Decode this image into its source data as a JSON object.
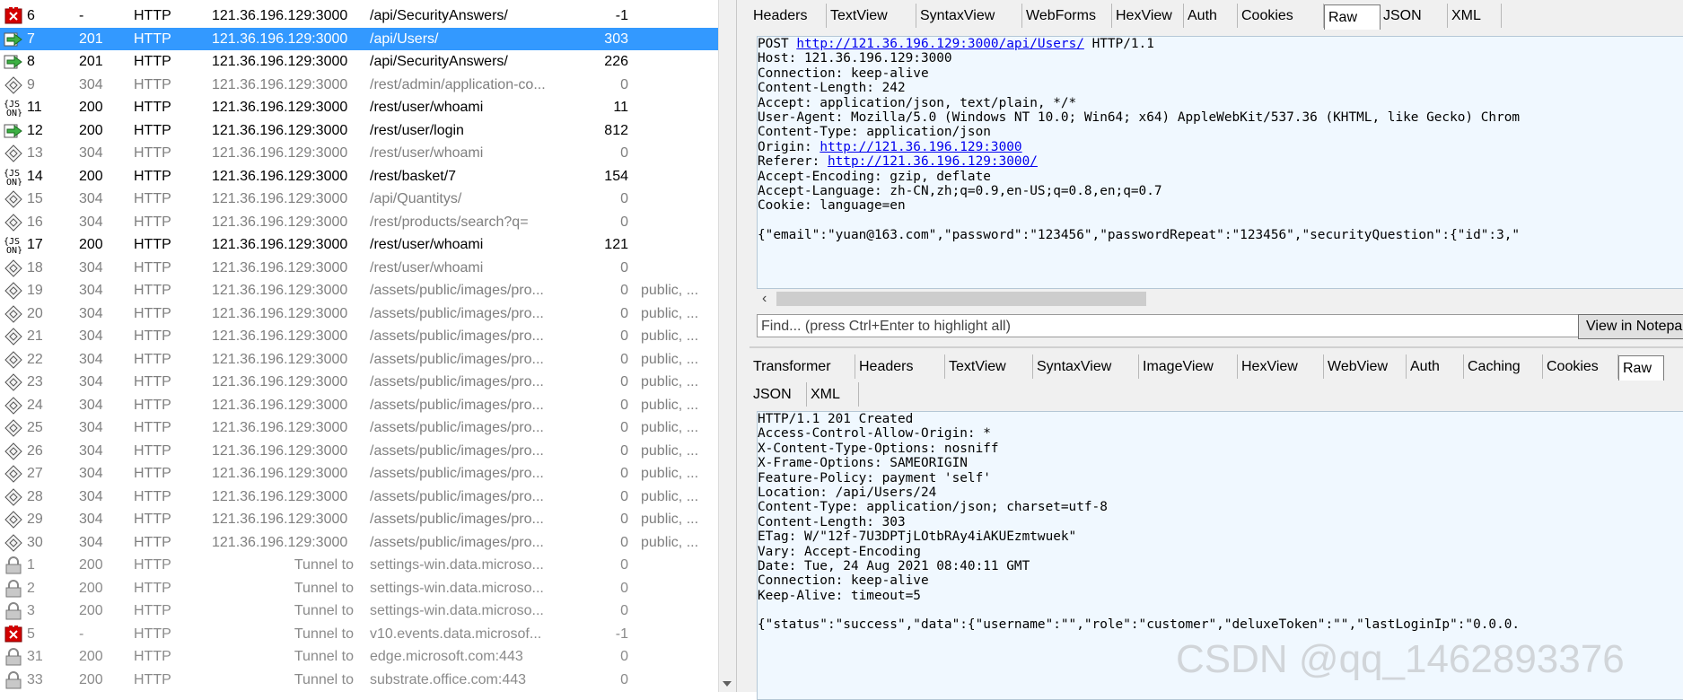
{
  "sessions": [
    {
      "num": "6",
      "result": "-",
      "protocol": "HTTP",
      "host": "121.36.196.129:3000",
      "url": "/api/SecurityAnswers/",
      "body": "-1",
      "caching": "",
      "icon": "error-icon",
      "style": "normal"
    },
    {
      "num": "7",
      "result": "201",
      "protocol": "HTTP",
      "host": "121.36.196.129:3000",
      "url": "/api/Users/",
      "body": "303",
      "caching": "",
      "icon": "post-arrow-icon",
      "style": "selected"
    },
    {
      "num": "8",
      "result": "201",
      "protocol": "HTTP",
      "host": "121.36.196.129:3000",
      "url": "/api/SecurityAnswers/",
      "body": "226",
      "caching": "",
      "icon": "post-arrow-icon",
      "style": "normal"
    },
    {
      "num": "9",
      "result": "304",
      "protocol": "HTTP",
      "host": "121.36.196.129:3000",
      "url": "/rest/admin/application-co...",
      "body": "0",
      "caching": "",
      "icon": "not-modified-icon",
      "style": "gray"
    },
    {
      "num": "11",
      "result": "200",
      "protocol": "HTTP",
      "host": "121.36.196.129:3000",
      "url": "/rest/user/whoami",
      "body": "11",
      "caching": "",
      "icon": "json-icon",
      "style": "normal"
    },
    {
      "num": "12",
      "result": "200",
      "protocol": "HTTP",
      "host": "121.36.196.129:3000",
      "url": "/rest/user/login",
      "body": "812",
      "caching": "",
      "icon": "post-arrow-icon",
      "style": "normal"
    },
    {
      "num": "13",
      "result": "304",
      "protocol": "HTTP",
      "host": "121.36.196.129:3000",
      "url": "/rest/user/whoami",
      "body": "0",
      "caching": "",
      "icon": "not-modified-icon",
      "style": "gray"
    },
    {
      "num": "14",
      "result": "200",
      "protocol": "HTTP",
      "host": "121.36.196.129:3000",
      "url": "/rest/basket/7",
      "body": "154",
      "caching": "",
      "icon": "json-icon",
      "style": "normal"
    },
    {
      "num": "15",
      "result": "304",
      "protocol": "HTTP",
      "host": "121.36.196.129:3000",
      "url": "/api/Quantitys/",
      "body": "0",
      "caching": "",
      "icon": "not-modified-icon",
      "style": "gray"
    },
    {
      "num": "16",
      "result": "304",
      "protocol": "HTTP",
      "host": "121.36.196.129:3000",
      "url": "/rest/products/search?q=",
      "body": "0",
      "caching": "",
      "icon": "not-modified-icon",
      "style": "gray"
    },
    {
      "num": "17",
      "result": "200",
      "protocol": "HTTP",
      "host": "121.36.196.129:3000",
      "url": "/rest/user/whoami",
      "body": "121",
      "caching": "",
      "icon": "json-icon",
      "style": "normal"
    },
    {
      "num": "18",
      "result": "304",
      "protocol": "HTTP",
      "host": "121.36.196.129:3000",
      "url": "/rest/user/whoami",
      "body": "0",
      "caching": "",
      "icon": "not-modified-icon",
      "style": "gray"
    },
    {
      "num": "19",
      "result": "304",
      "protocol": "HTTP",
      "host": "121.36.196.129:3000",
      "url": "/assets/public/images/pro...",
      "body": "0",
      "caching": "public, ...",
      "icon": "not-modified-icon",
      "style": "gray"
    },
    {
      "num": "20",
      "result": "304",
      "protocol": "HTTP",
      "host": "121.36.196.129:3000",
      "url": "/assets/public/images/pro...",
      "body": "0",
      "caching": "public, ...",
      "icon": "not-modified-icon",
      "style": "gray"
    },
    {
      "num": "21",
      "result": "304",
      "protocol": "HTTP",
      "host": "121.36.196.129:3000",
      "url": "/assets/public/images/pro...",
      "body": "0",
      "caching": "public, ...",
      "icon": "not-modified-icon",
      "style": "gray"
    },
    {
      "num": "22",
      "result": "304",
      "protocol": "HTTP",
      "host": "121.36.196.129:3000",
      "url": "/assets/public/images/pro...",
      "body": "0",
      "caching": "public, ...",
      "icon": "not-modified-icon",
      "style": "gray"
    },
    {
      "num": "23",
      "result": "304",
      "protocol": "HTTP",
      "host": "121.36.196.129:3000",
      "url": "/assets/public/images/pro...",
      "body": "0",
      "caching": "public, ...",
      "icon": "not-modified-icon",
      "style": "gray"
    },
    {
      "num": "24",
      "result": "304",
      "protocol": "HTTP",
      "host": "121.36.196.129:3000",
      "url": "/assets/public/images/pro...",
      "body": "0",
      "caching": "public, ...",
      "icon": "not-modified-icon",
      "style": "gray"
    },
    {
      "num": "25",
      "result": "304",
      "protocol": "HTTP",
      "host": "121.36.196.129:3000",
      "url": "/assets/public/images/pro...",
      "body": "0",
      "caching": "public, ...",
      "icon": "not-modified-icon",
      "style": "gray"
    },
    {
      "num": "26",
      "result": "304",
      "protocol": "HTTP",
      "host": "121.36.196.129:3000",
      "url": "/assets/public/images/pro...",
      "body": "0",
      "caching": "public, ...",
      "icon": "not-modified-icon",
      "style": "gray"
    },
    {
      "num": "27",
      "result": "304",
      "protocol": "HTTP",
      "host": "121.36.196.129:3000",
      "url": "/assets/public/images/pro...",
      "body": "0",
      "caching": "public, ...",
      "icon": "not-modified-icon",
      "style": "gray"
    },
    {
      "num": "28",
      "result": "304",
      "protocol": "HTTP",
      "host": "121.36.196.129:3000",
      "url": "/assets/public/images/pro...",
      "body": "0",
      "caching": "public, ...",
      "icon": "not-modified-icon",
      "style": "gray"
    },
    {
      "num": "29",
      "result": "304",
      "protocol": "HTTP",
      "host": "121.36.196.129:3000",
      "url": "/assets/public/images/pro...",
      "body": "0",
      "caching": "public, ...",
      "icon": "not-modified-icon",
      "style": "gray"
    },
    {
      "num": "30",
      "result": "304",
      "protocol": "HTTP",
      "host": "121.36.196.129:3000",
      "url": "/assets/public/images/pro...",
      "body": "0",
      "caching": "public, ...",
      "icon": "not-modified-icon",
      "style": "gray"
    },
    {
      "num": "1",
      "result": "200",
      "protocol": "HTTP",
      "host": "Tunnel to",
      "url": "settings-win.data.microso...",
      "body": "0",
      "caching": "",
      "icon": "lock-icon",
      "style": "dim"
    },
    {
      "num": "2",
      "result": "200",
      "protocol": "HTTP",
      "host": "Tunnel to",
      "url": "settings-win.data.microso...",
      "body": "0",
      "caching": "",
      "icon": "lock-icon",
      "style": "dim"
    },
    {
      "num": "3",
      "result": "200",
      "protocol": "HTTP",
      "host": "Tunnel to",
      "url": "settings-win.data.microso...",
      "body": "0",
      "caching": "",
      "icon": "lock-icon",
      "style": "dim"
    },
    {
      "num": "5",
      "result": "-",
      "protocol": "HTTP",
      "host": "Tunnel to",
      "url": "v10.events.data.microsof...",
      "body": "-1",
      "caching": "",
      "icon": "error-icon",
      "style": "dim"
    },
    {
      "num": "31",
      "result": "200",
      "protocol": "HTTP",
      "host": "Tunnel to",
      "url": "edge.microsoft.com:443",
      "body": "0",
      "caching": "",
      "icon": "lock-icon",
      "style": "dim"
    },
    {
      "num": "33",
      "result": "200",
      "protocol": "HTTP",
      "host": "Tunnel to",
      "url": "substrate.office.com:443",
      "body": "0",
      "caching": "",
      "icon": "lock-icon",
      "style": "dim"
    }
  ],
  "request_tabs": [
    "Headers",
    "TextView",
    "SyntaxView",
    "WebForms",
    "HexView",
    "Auth",
    "Cookies",
    "Raw",
    "JSON",
    "XML"
  ],
  "request_active_tab": "Raw",
  "request_lines": [
    {
      "pre": "POST ",
      "link": "http://121.36.196.129:3000/api/Users/",
      "post": " HTTP/1.1"
    },
    {
      "pre": "Host: 121.36.196.129:3000",
      "link": "",
      "post": ""
    },
    {
      "pre": "Connection: keep-alive",
      "link": "",
      "post": ""
    },
    {
      "pre": "Content-Length: 242",
      "link": "",
      "post": ""
    },
    {
      "pre": "Accept: application/json, text/plain, */*",
      "link": "",
      "post": ""
    },
    {
      "pre": "User-Agent: Mozilla/5.0 (Windows NT 10.0; Win64; x64) AppleWebKit/537.36 (KHTML, like Gecko) Chrom",
      "link": "",
      "post": ""
    },
    {
      "pre": "Content-Type: application/json",
      "link": "",
      "post": ""
    },
    {
      "pre": "Origin: ",
      "link": "http://121.36.196.129:3000",
      "post": ""
    },
    {
      "pre": "Referer: ",
      "link": "http://121.36.196.129:3000/",
      "post": ""
    },
    {
      "pre": "Accept-Encoding: gzip, deflate",
      "link": "",
      "post": ""
    },
    {
      "pre": "Accept-Language: zh-CN,zh;q=0.9,en-US;q=0.8,en;q=0.7",
      "link": "",
      "post": ""
    },
    {
      "pre": "Cookie: language=en",
      "link": "",
      "post": ""
    },
    {
      "pre": "",
      "link": "",
      "post": ""
    },
    {
      "pre": "{\"email\":\"yuan@163.com\",\"password\":\"123456\",\"passwordRepeat\":\"123456\",\"securityQuestion\":{\"id\":3,\"",
      "link": "",
      "post": ""
    }
  ],
  "find_placeholder": "Find... (press Ctrl+Enter to highlight all)",
  "view_in_notepad_label": "View in Notepa",
  "response_tabs_row1": [
    "Transformer",
    "Headers",
    "TextView",
    "SyntaxView",
    "ImageView",
    "HexView",
    "WebView",
    "Auth",
    "Caching",
    "Cookies",
    "Raw"
  ],
  "response_tabs_row2": [
    "JSON",
    "XML"
  ],
  "response_active_tab": "Raw",
  "response_lines": [
    "HTTP/1.1 201 Created",
    "Access-Control-Allow-Origin: *",
    "X-Content-Type-Options: nosniff",
    "X-Frame-Options: SAMEORIGIN",
    "Feature-Policy: payment 'self'",
    "Location: /api/Users/24",
    "Content-Type: application/json; charset=utf-8",
    "Content-Length: 303",
    "ETag: W/\"12f-7U3DPTjLOtbRAy4iAKUEzmtwuek\"",
    "Vary: Accept-Encoding",
    "Date: Tue, 24 Aug 2021 08:40:11 GMT",
    "Connection: keep-alive",
    "Keep-Alive: timeout=5",
    "",
    "{\"status\":\"success\",\"data\":{\"username\":\"\",\"role\":\"customer\",\"deluxeToken\":\"\",\"lastLoginIp\":\"0.0.0."
  ],
  "watermark": "CSDN @qq_1462893376",
  "colors": {
    "selection": "#3399ff",
    "pane_bg": "#f0f8ff",
    "link": "#0000ee"
  }
}
